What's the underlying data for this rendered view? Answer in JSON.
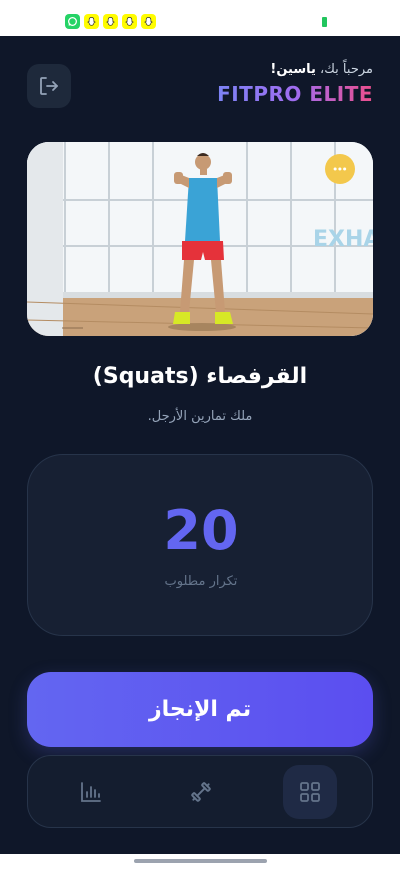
{
  "status_bar": {
    "notification_icons": [
      "whatsapp-icon",
      "snapchat-icon",
      "snapchat-icon",
      "snapchat-icon",
      "snapchat-icon"
    ]
  },
  "header": {
    "greeting_prefix": "مرحباً بك،",
    "user_name": "ياسين!",
    "brand": "FITPRO ELITE",
    "logout_icon": "logout-icon"
  },
  "video": {
    "overlay_text": "EXHALE"
  },
  "exercise": {
    "title": "القرفصاء (Squats)",
    "subtitle": "ملك تمارين الأرجل."
  },
  "reps": {
    "count": "20",
    "label": "تكرار مطلوب"
  },
  "actions": {
    "done_label": "تم الإنجاز"
  },
  "bottom_nav": {
    "items": [
      {
        "icon": "stats-icon",
        "active": false
      },
      {
        "icon": "dumbbell-icon",
        "active": false
      },
      {
        "icon": "grid-icon",
        "active": true
      }
    ]
  },
  "colors": {
    "background": "#0f1729",
    "accent": "#6366f1",
    "brand_gradient_start": "#7c83f5",
    "brand_gradient_end": "#ec4e8c"
  }
}
